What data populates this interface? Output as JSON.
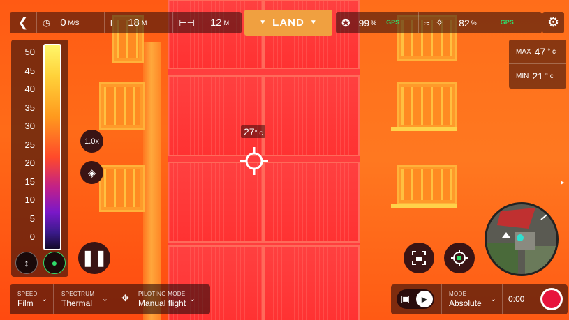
{
  "topbar": {
    "back_icon": "chevron-left-icon",
    "speed": {
      "icon": "speedometer-icon",
      "value": "0",
      "unit": "M/S"
    },
    "altitude": {
      "icon": "altitude-icon",
      "value": "18",
      "unit": "M"
    },
    "distance": {
      "icon": "distance-icon",
      "value": "12",
      "unit": "M"
    },
    "land_label": "LAND",
    "controller_battery": {
      "icon": "controller-icon",
      "value": "99",
      "unit": "%"
    },
    "controller_gps": "GPS",
    "wifi_icon": "wifi-icon",
    "drone_battery": {
      "icon": "drone-icon",
      "value": "82",
      "unit": "%"
    },
    "drone_gps": "GPS",
    "settings_icon": "gear-icon"
  },
  "thermal_scale": {
    "labels": [
      "50",
      "45",
      "40",
      "35",
      "30",
      "25",
      "20",
      "15",
      "10",
      "5",
      "0"
    ],
    "lock_icon": "vertical-arrows-icon",
    "thermometer_icon": "thermometer-icon"
  },
  "overlay": {
    "zoom": "1.0x",
    "layers_icon": "layers-icon",
    "spot_temp": "27",
    "spot_unit": "° c",
    "max_label": "MAX",
    "max_value": "47",
    "max_unit": "° c",
    "min_label": "MIN",
    "min_value": "21",
    "min_unit": "° c",
    "pause_icon": "pause-icon",
    "screenshot_icon": "camera-frame-icon",
    "target_icon": "target-icon"
  },
  "bottom_left": {
    "speed_label": "SPEED",
    "speed_value": "Film",
    "spectrum_label": "SPECTRUM",
    "spectrum_value": "Thermal",
    "piloting_label": "PILOTING MODE",
    "piloting_value": "Manual flight"
  },
  "bottom_right": {
    "mode_label": "MODE",
    "mode_value": "Absolute",
    "timer": "0:00"
  },
  "colors": {
    "land_bg": "#f0a040",
    "gps_green": "#2fdc6a",
    "record_red": "#e8143c",
    "thermal_surface": "#ff3e3e",
    "thermal_facade": "#ff6d1a"
  }
}
